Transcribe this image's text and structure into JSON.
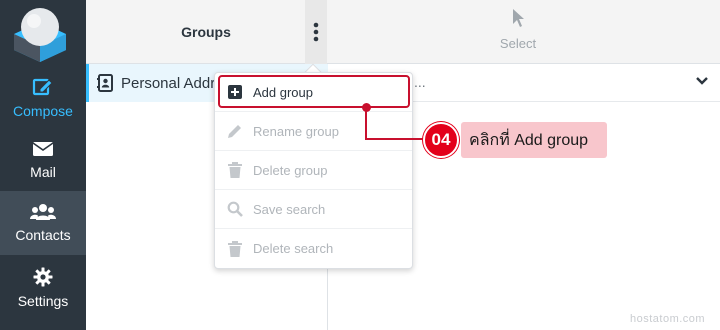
{
  "sidebar": {
    "items": [
      {
        "label": "Compose",
        "icon": "compose-icon"
      },
      {
        "label": "Mail",
        "icon": "mail-icon"
      },
      {
        "label": "Contacts",
        "icon": "contacts-icon"
      },
      {
        "label": "Settings",
        "icon": "gear-icon"
      }
    ]
  },
  "groups": {
    "title": "Groups",
    "items": [
      {
        "label": "Personal Addresses"
      }
    ]
  },
  "toolbar": {
    "select_label": "Select"
  },
  "list": {
    "row_text": "..."
  },
  "menu": {
    "items": [
      {
        "label": "Add group",
        "icon": "plus-square-icon",
        "enabled": true
      },
      {
        "label": "Rename group",
        "icon": "pencil-icon",
        "enabled": false
      },
      {
        "label": "Delete group",
        "icon": "trash-icon",
        "enabled": false
      },
      {
        "label": "Save search",
        "icon": "search-icon",
        "enabled": false
      },
      {
        "label": "Delete search",
        "icon": "trash-icon",
        "enabled": false
      }
    ]
  },
  "annotation": {
    "step_number": "04",
    "text": "คลิกที่ Add group"
  },
  "watermark": "hostatom.com",
  "colors": {
    "sidebar_bg": "#2c363f",
    "accent": "#37beff",
    "annotation_red": "#e3001b",
    "callout_bg": "#f8c6cc"
  }
}
